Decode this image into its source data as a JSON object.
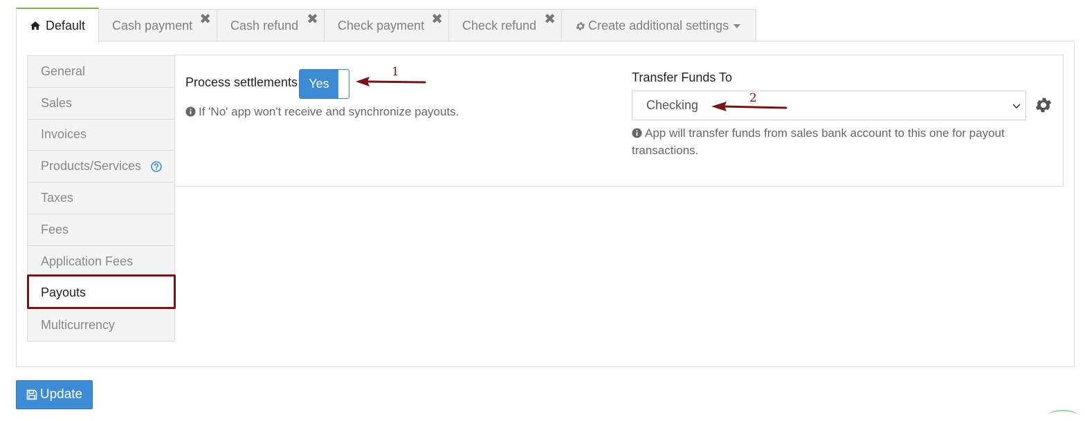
{
  "tabs": [
    {
      "label": "Default",
      "icon": "home-icon",
      "active": true
    },
    {
      "label": "Cash payment",
      "closable": true
    },
    {
      "label": "Cash refund",
      "closable": true
    },
    {
      "label": "Check payment",
      "closable": true
    },
    {
      "label": "Check refund",
      "closable": true
    },
    {
      "label": "Create additional settings",
      "icon": "gear-icon",
      "dropdown": true
    }
  ],
  "tab_close_glyph": "✖",
  "sidebar": {
    "items": [
      {
        "label": "General"
      },
      {
        "label": "Sales"
      },
      {
        "label": "Invoices"
      },
      {
        "label": "Products/Services",
        "help_icon": "question-circle-icon"
      },
      {
        "label": "Taxes"
      },
      {
        "label": "Fees"
      },
      {
        "label": "Application Fees"
      },
      {
        "label": "Payouts",
        "active": true
      },
      {
        "label": "Multicurrency"
      }
    ]
  },
  "settings": {
    "process_settlements": {
      "label": "Process settlements",
      "toggle_value": "Yes",
      "help": "If 'No' app won't receive and synchronize payouts."
    },
    "transfer_funds": {
      "label": "Transfer Funds To",
      "selected": "Checking",
      "help": "App will transfer funds from sales bank account to this one for payout transactions."
    }
  },
  "annotations": {
    "arrow1_number": "1",
    "arrow2_number": "2",
    "color": "#7a1318"
  },
  "footer": {
    "update_label": "Update",
    "icon": "save-icon"
  },
  "colors": {
    "accent": "#3d8bd4",
    "active_tab_border": "#7cb342",
    "highlight": "#7a1318"
  }
}
